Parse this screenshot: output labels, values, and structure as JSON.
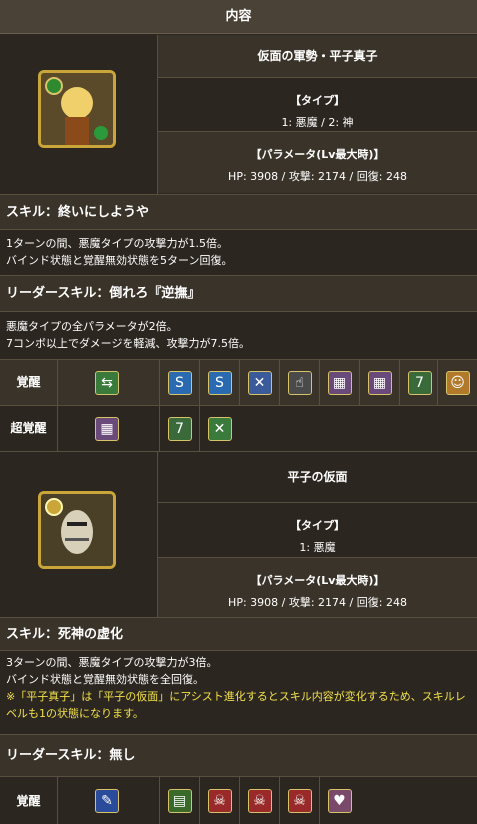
{
  "header": {
    "title": "内容"
  },
  "card1": {
    "name": "仮面の軍勢・平子真子",
    "type_label": "【タイプ】",
    "type_value": "1: 悪魔 / 2: 神",
    "param_label": "【パラメータ(Lv最大時)】",
    "param_value": "HP: 3908 / 攻撃: 2174 / 回復: 248",
    "skill_title": "スキル：終いにしようや",
    "skill_desc": [
      "1ターンの間、悪魔タイプの攻撃力が1.5倍。",
      "バインド状態と覚醒無効状態を5ターン回復。"
    ],
    "leader_title": "リーダースキル：倒れろ『逆撫』",
    "leader_desc": [
      "悪魔タイプの全パラメータが2倍。",
      "7コンボ以上でダメージを軽減、攻撃力が7.5倍。"
    ],
    "awakening_label": "覚醒",
    "awakenings": [
      "sbr-icon",
      "combo-drop-icon",
      "combo-drop-icon",
      "jammer-resist-icon",
      "two-way-icon",
      "seven-combo-icon",
      "seven-combo-icon",
      "seven-combo-plus-icon",
      "bind-resist-icon"
    ],
    "super_awakening_label": "超覚醒",
    "super_awakenings": [
      "seven-combo-icon",
      "seven-combo-plus-icon",
      "sbr-icon"
    ]
  },
  "card2": {
    "name": "平子の仮面",
    "type_label": "【タイプ】",
    "type_value": "1: 悪魔",
    "param_label": "【パラメータ(Lv最大時)】",
    "param_value": "HP: 3908 / 攻撃: 2174 / 回復: 248",
    "skill_title": "スキル：死神の虚化",
    "skill_desc": [
      "3ターンの間、悪魔タイプの攻撃力が3倍。",
      "バインド状態と覚醒無効状態を全回復。"
    ],
    "skill_note": "※「平子真子」は「平子の仮面」にアシスト進化するとスキル内容が変化するため、スキルレベルも1の状態になります。",
    "leader_title": "リーダースキル：無し",
    "awakening_label": "覚醒",
    "awakenings": [
      "skill-boost-icon",
      "sb-plus-icon",
      "devil-killer-icon",
      "devil-killer-icon",
      "devil-killer-icon",
      "heart-plus-icon"
    ]
  },
  "colors": {
    "bg": "#2b2620",
    "row": "#3a332a",
    "border": "#57503f",
    "warn": "#f2e04a"
  }
}
